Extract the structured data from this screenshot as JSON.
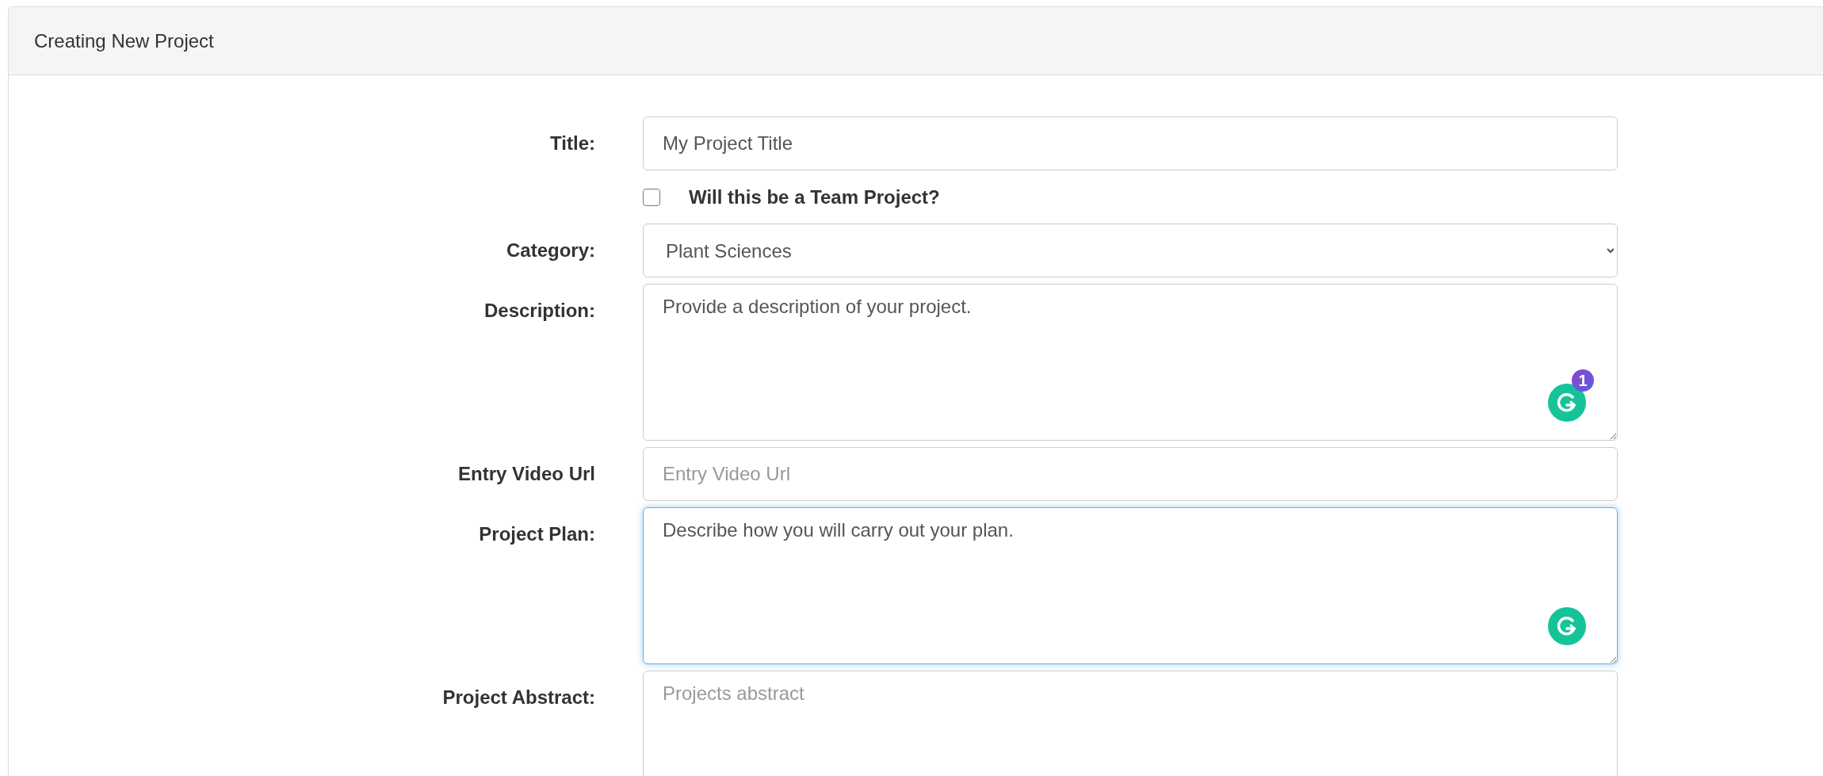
{
  "panel": {
    "title": "Creating New Project"
  },
  "fields": [
    {
      "kind": "input",
      "label": "Title:",
      "value": "My Project Title",
      "focused": false
    },
    {
      "kind": "checkbox",
      "label": "Will this be a Team Project?",
      "checked": false
    },
    {
      "kind": "select",
      "label": "Category:",
      "value": "Plant Sciences",
      "focused": false
    },
    {
      "kind": "textarea",
      "label": "Description:",
      "value": "Provide a description of your project.",
      "focused": false,
      "grammar_icon": true,
      "grammar_count": "1"
    },
    {
      "kind": "input",
      "label": "Entry Video Url",
      "placeholder": "Entry Video Url",
      "focused": false
    },
    {
      "kind": "textarea",
      "label": "Project Plan:",
      "value": "Describe how you will carry out your plan.",
      "focused": true,
      "grammar_icon": true
    },
    {
      "kind": "textarea",
      "label": "Project Abstract:",
      "placeholder": "Projects abstract",
      "focused": false,
      "grammar_icon": false
    }
  ]
}
